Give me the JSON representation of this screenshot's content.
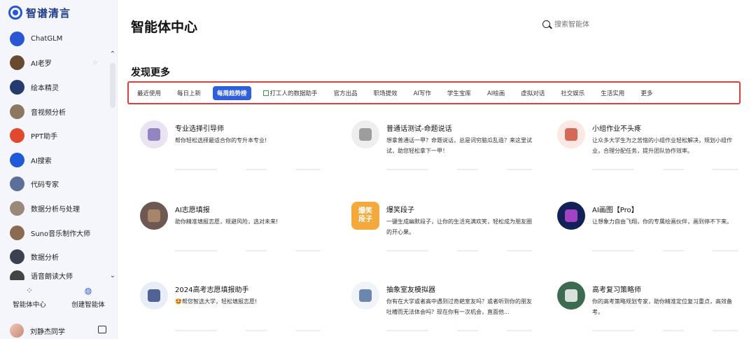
{
  "brand": {
    "name": "智谱清言"
  },
  "sidebar": {
    "items": [
      {
        "label": "ChatGLM",
        "icon": "chatglm-icon",
        "color": "#2a56d6"
      },
      {
        "label": "AI老罗",
        "icon": "avatar-ailuo",
        "color": "#6a4a2f",
        "pin": "☆"
      },
      {
        "label": "绘本精灵",
        "icon": "avatar-huiben",
        "color": "#233b6e"
      },
      {
        "label": "音视频分析",
        "icon": "avatar-av-analysis",
        "color": "#8e7760"
      },
      {
        "label": "PPT助手",
        "icon": "ppt-icon",
        "color": "#e2482b"
      },
      {
        "label": "AI搜索",
        "icon": "ai-search-icon",
        "color": "#1f5ad8"
      },
      {
        "label": "代码专家",
        "icon": "avatar-code-expert",
        "color": "#5b6f9a"
      },
      {
        "label": "数据分析与处理",
        "icon": "avatar-data-processing",
        "color": "#9a8878"
      },
      {
        "label": "Suno音乐制作大师",
        "icon": "avatar-suno",
        "color": "#8c6a52"
      },
      {
        "label": "数据分析",
        "icon": "code-brackets-icon",
        "color": "#3b4150"
      },
      {
        "label": "语音朗读大师",
        "icon": "panda-icon",
        "color": "#444444"
      }
    ],
    "tools": [
      {
        "label": "智能体中心",
        "icon": "grid-dots-icon"
      },
      {
        "label": "创建智能体",
        "icon": "create-agent-icon"
      }
    ],
    "user": {
      "name": "刘静杰同学"
    }
  },
  "main": {
    "title": "智能体中心",
    "search": {
      "placeholder": "搜索智能体"
    },
    "section_title": "发现更多",
    "tabs": [
      {
        "label": "最近使用"
      },
      {
        "label": "每日上新"
      },
      {
        "label": "每周趋势榜",
        "active": true
      },
      {
        "label": "打工人的数据助手",
        "icon": "chart-icon"
      },
      {
        "label": "官方出品"
      },
      {
        "label": "职场提效"
      },
      {
        "label": "AI写作"
      },
      {
        "label": "学生宝库"
      },
      {
        "label": "AI绘画"
      },
      {
        "label": "虚拟对话"
      },
      {
        "label": "社交娱乐"
      },
      {
        "label": "生活实用"
      },
      {
        "label": "更多"
      }
    ],
    "cards": [
      {
        "title": "专业选择引导师",
        "desc": "帮你轻松选择最适合你的专升本专业!",
        "thumb": "#e9e3f2",
        "accent": "#7d6bb5"
      },
      {
        "title": "普通话测试-命题说话",
        "desc": "想拿普通话一甲？命题说话，总是词穷脑瓜乱造？来这里试试，助您轻松拿下一甲！",
        "thumb": "#eeeeee",
        "accent": "#888888"
      },
      {
        "title": "小组作业不头疼",
        "desc": "让众多大学生为之苦恼的小组作业轻松解决，规划小组作业，合理分配任务，提升团队协作效率。",
        "thumb": "#fbe7e3",
        "accent": "#c94a36"
      },
      {
        "title": "AI志愿填报",
        "desc": "助你精准填报志愿，规避风险，选对未来!",
        "thumb": "#6c5a52",
        "accent": "#b68f70"
      },
      {
        "title": "爆笑段子",
        "desc": "一键生成幽默段子，让你的生活充满欢笑，轻松成为朋友圈的开心果。",
        "thumb": "#f4a93a",
        "accent": "#ffffff",
        "thumb_text": "爆笑段子"
      },
      {
        "title": "AI画图【Pro】",
        "desc": "让想象力自由飞翔，你的专属绘画伙伴，画到停不下来。",
        "thumb": "#142158",
        "accent": "#c54be0"
      },
      {
        "title": "2024高考志愿填报助手",
        "desc": "🤩帮您智选大学，轻松填报志愿!",
        "thumb": "#e8eef8",
        "accent": "#2b3f7a"
      },
      {
        "title": "抽象室友模拟器",
        "desc": "你有在大学或者高中遇到过奇葩室友吗？或者听到你的朋友吐槽而无法体会吗？现在你有一次机会，直面他...",
        "thumb": "#f0f4f8",
        "accent": "#4b6a9a"
      },
      {
        "title": "高考复习策略师",
        "desc": "你的高考策略规划专家，助你精准定位复习重点，高效备考。",
        "thumb": "#3d6b50",
        "accent": "#ffffff"
      }
    ]
  }
}
